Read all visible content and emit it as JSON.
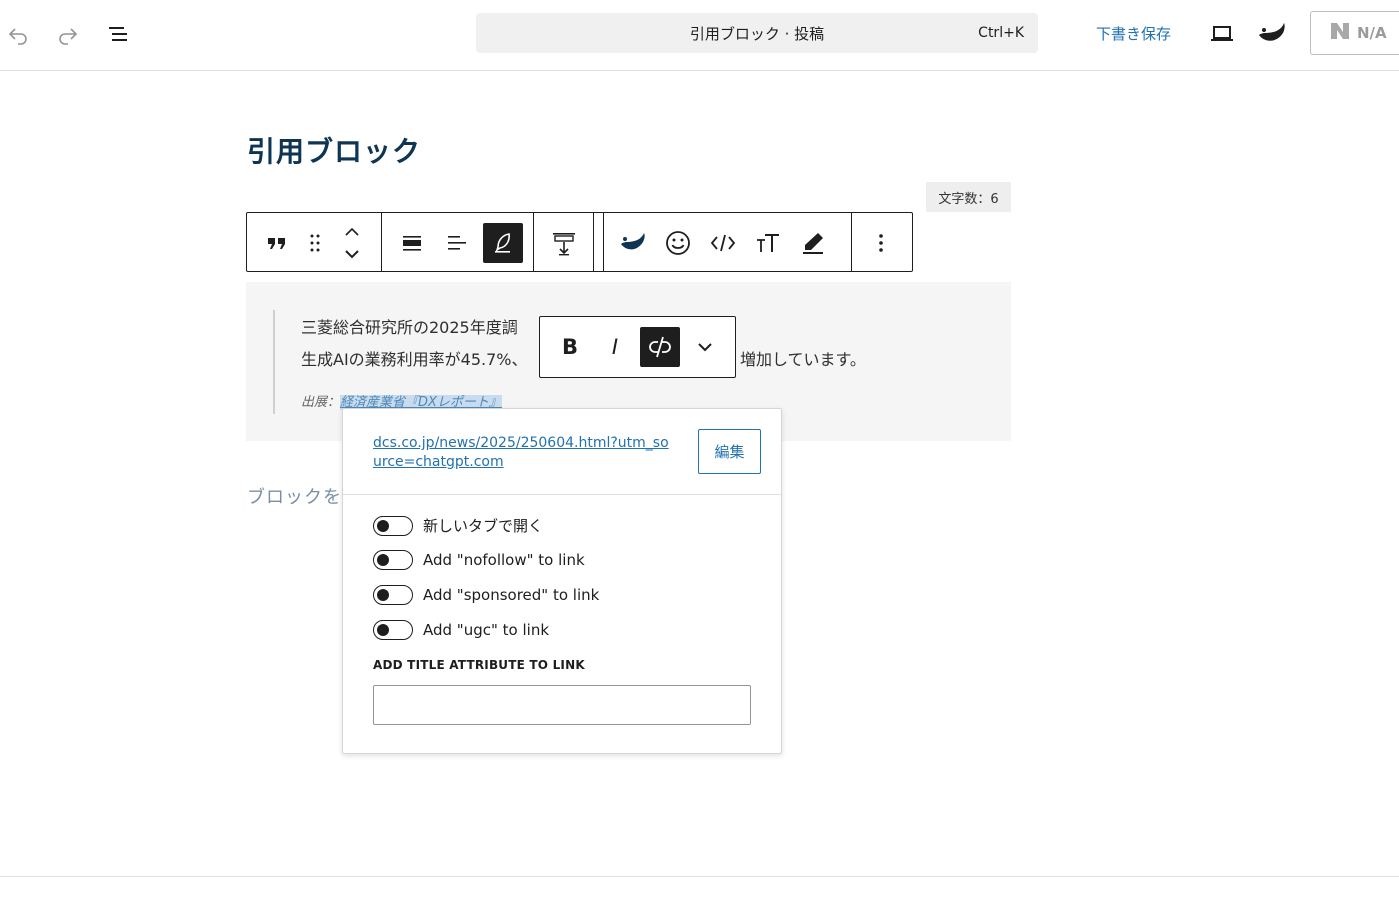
{
  "topbar": {
    "command_title": "引用ブロック · 投稿",
    "command_shortcut": "Ctrl+K",
    "save_draft_label": "下書き保存",
    "na_label": "N/A",
    "icons": [
      "undo-icon",
      "redo-icon",
      "document-overview-icon",
      "preview-icon",
      "plugin-leaf-icon",
      "na-plugin-icon"
    ]
  },
  "editor": {
    "post_title": "引用ブロック",
    "word_count_label": "文字数：6",
    "placeholder": "ブロックを"
  },
  "quote": {
    "line1": "三菱総合研究所の2025年度調",
    "line2_start": "生成AIの業務利用率が45.7%、",
    "line2_end": "増加しています。",
    "citation_prefix": "出展：",
    "citation_link": "経済産業省『DXレポート』"
  },
  "block_toolbar": {
    "buttons": [
      "quote-icon",
      "drag-handle-icon",
      "move-up-icon",
      "move-down-icon",
      "align-center-icon",
      "align-left-icon",
      "style-feather-icon",
      "spacing-icon",
      "leaf-icon",
      "emoji-icon",
      "code-icon",
      "font-size-icon",
      "highlight-icon",
      "more-options-icon"
    ],
    "active": "style-feather-icon"
  },
  "format_toolbar": {
    "bold_label": "B",
    "italic_label": "I",
    "active": "unlink-icon"
  },
  "link_popover": {
    "url": "dcs.co.jp/news/2025/250604.html?utm_source=chatgpt.com",
    "edit_label": "編集",
    "toggles": [
      {
        "label": "新しいタブで開く",
        "on": false
      },
      {
        "label": "Add \"nofollow\" to link",
        "on": false
      },
      {
        "label": "Add \"sponsored\" to link",
        "on": false
      },
      {
        "label": "Add \"ugc\" to link",
        "on": false
      }
    ],
    "title_attr_label": "ADD TITLE ATTRIBUTE TO LINK",
    "title_attr_value": ""
  },
  "colors": {
    "accent": "#2271b1",
    "title": "#0e3553",
    "dark": "#1e1e1e",
    "quote_bg": "#f5f5f5"
  }
}
